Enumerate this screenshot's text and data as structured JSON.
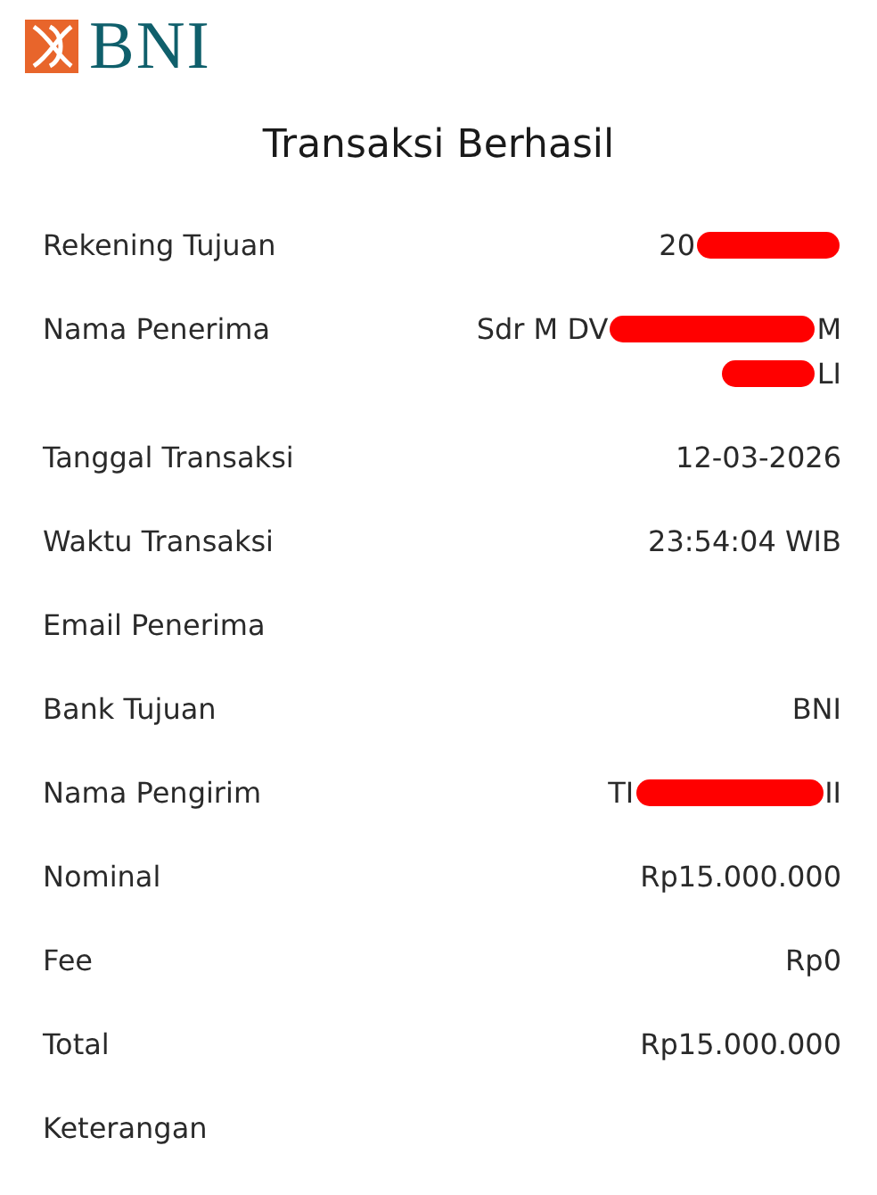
{
  "brand": {
    "name": "BNI"
  },
  "title": "Transaksi Berhasil",
  "rows": [
    {
      "label": "Rekening Tujuan",
      "lines": [
        [
          {
            "kind": "text",
            "text": "20"
          },
          {
            "kind": "redaction"
          }
        ]
      ]
    },
    {
      "label": "Nama Penerima",
      "lines": [
        [
          {
            "kind": "text",
            "text": "Sdr M DV"
          },
          {
            "kind": "redaction"
          },
          {
            "kind": "text",
            "text": "M"
          }
        ],
        [
          {
            "kind": "redaction"
          },
          {
            "kind": "text",
            "text": "LI"
          }
        ]
      ]
    },
    {
      "label": "Tanggal Transaksi",
      "lines": [
        [
          {
            "kind": "text",
            "text": "12-03-2026"
          }
        ]
      ]
    },
    {
      "label": "Waktu Transaksi",
      "lines": [
        [
          {
            "kind": "text",
            "text": "23:54:04 WIB"
          }
        ]
      ]
    },
    {
      "label": "Email Penerima",
      "lines": []
    },
    {
      "label": "Bank Tujuan",
      "lines": [
        [
          {
            "kind": "text",
            "text": "BNI"
          }
        ]
      ]
    },
    {
      "label": "Nama Pengirim",
      "lines": [
        [
          {
            "kind": "text",
            "text": "TI"
          },
          {
            "kind": "redaction"
          },
          {
            "kind": "text",
            "text": "II"
          }
        ]
      ]
    },
    {
      "label": "Nominal",
      "lines": [
        [
          {
            "kind": "text",
            "text": "Rp15.000.000"
          }
        ]
      ]
    },
    {
      "label": "Fee",
      "lines": [
        [
          {
            "kind": "text",
            "text": "Rp0"
          }
        ]
      ]
    },
    {
      "label": "Total",
      "lines": [
        [
          {
            "kind": "text",
            "text": "Rp15.000.000"
          }
        ]
      ]
    },
    {
      "label": "Keterangan",
      "lines": []
    }
  ]
}
